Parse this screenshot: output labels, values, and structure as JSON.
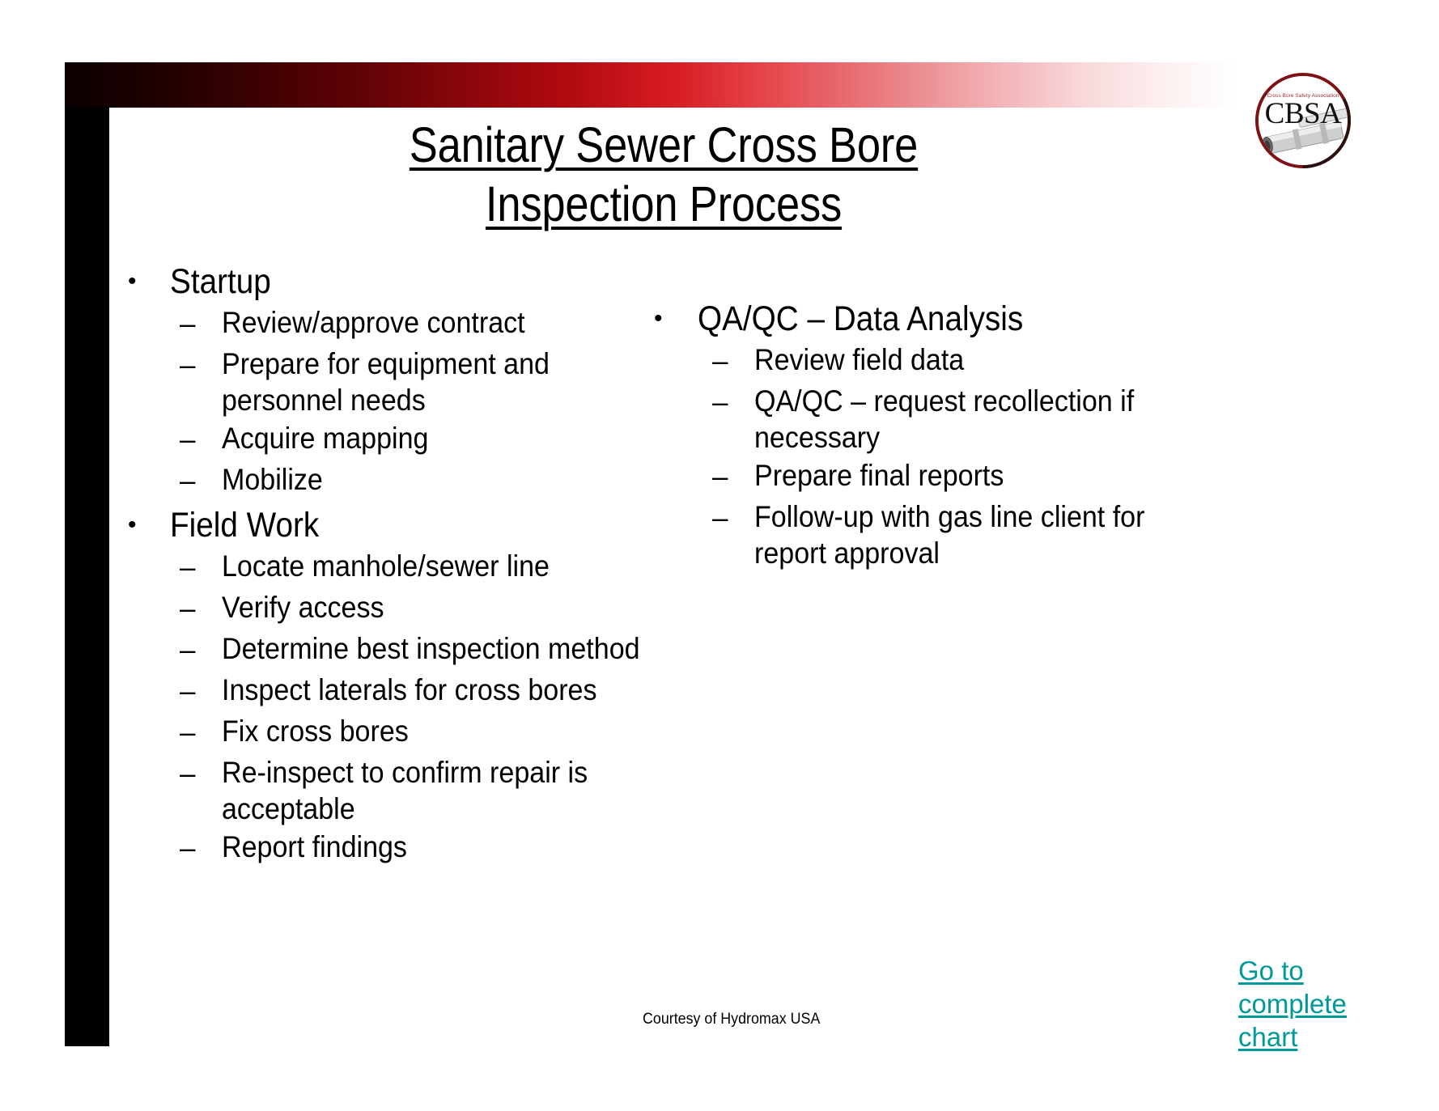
{
  "slide": {
    "title_lines": [
      "Sanitary Sewer Cross Bore",
      "Inspection Process"
    ],
    "credit": "Courtesy of  Hydromax USA",
    "accent_gradient_start": "#0b0000",
    "accent_gradient_mid": "#d81d23",
    "accent_gradient_end": "#ffffff",
    "sidebar_color": "#000000",
    "link_color": "#009999"
  },
  "logo": {
    "acronym": "CBSA",
    "tagline": "Cross Bore Safety Association",
    "ring_color": "#8c1a1a",
    "text_color": "#000000",
    "tagline_color": "#9d2a2a"
  },
  "columns": {
    "left": [
      {
        "label": "Startup",
        "bullet": "•",
        "sub_bullet": "–",
        "items": [
          "Review/approve contract",
          "Prepare for equipment and personnel needs",
          "Acquire mapping",
          "Mobilize"
        ]
      },
      {
        "label": "Field Work",
        "bullet": "•",
        "sub_bullet": "–",
        "items": [
          "Locate manhole/sewer line",
          "Verify access",
          "Determine best inspection method",
          "Inspect laterals for cross bores",
          "Fix cross bores",
          "Re-inspect to confirm repair is acceptable",
          "Report findings"
        ]
      }
    ],
    "right": [
      {
        "label": "QA/QC – Data Analysis",
        "bullet": "•",
        "sub_bullet": "–",
        "items": [
          "Review field data",
          "QA/QC – request recollection if necessary",
          "Prepare final reports",
          "Follow-up with gas line client for report approval"
        ]
      }
    ]
  },
  "link": {
    "words": [
      "Go to",
      "complete",
      "chart"
    ],
    "full_text": "Go to complete chart"
  }
}
